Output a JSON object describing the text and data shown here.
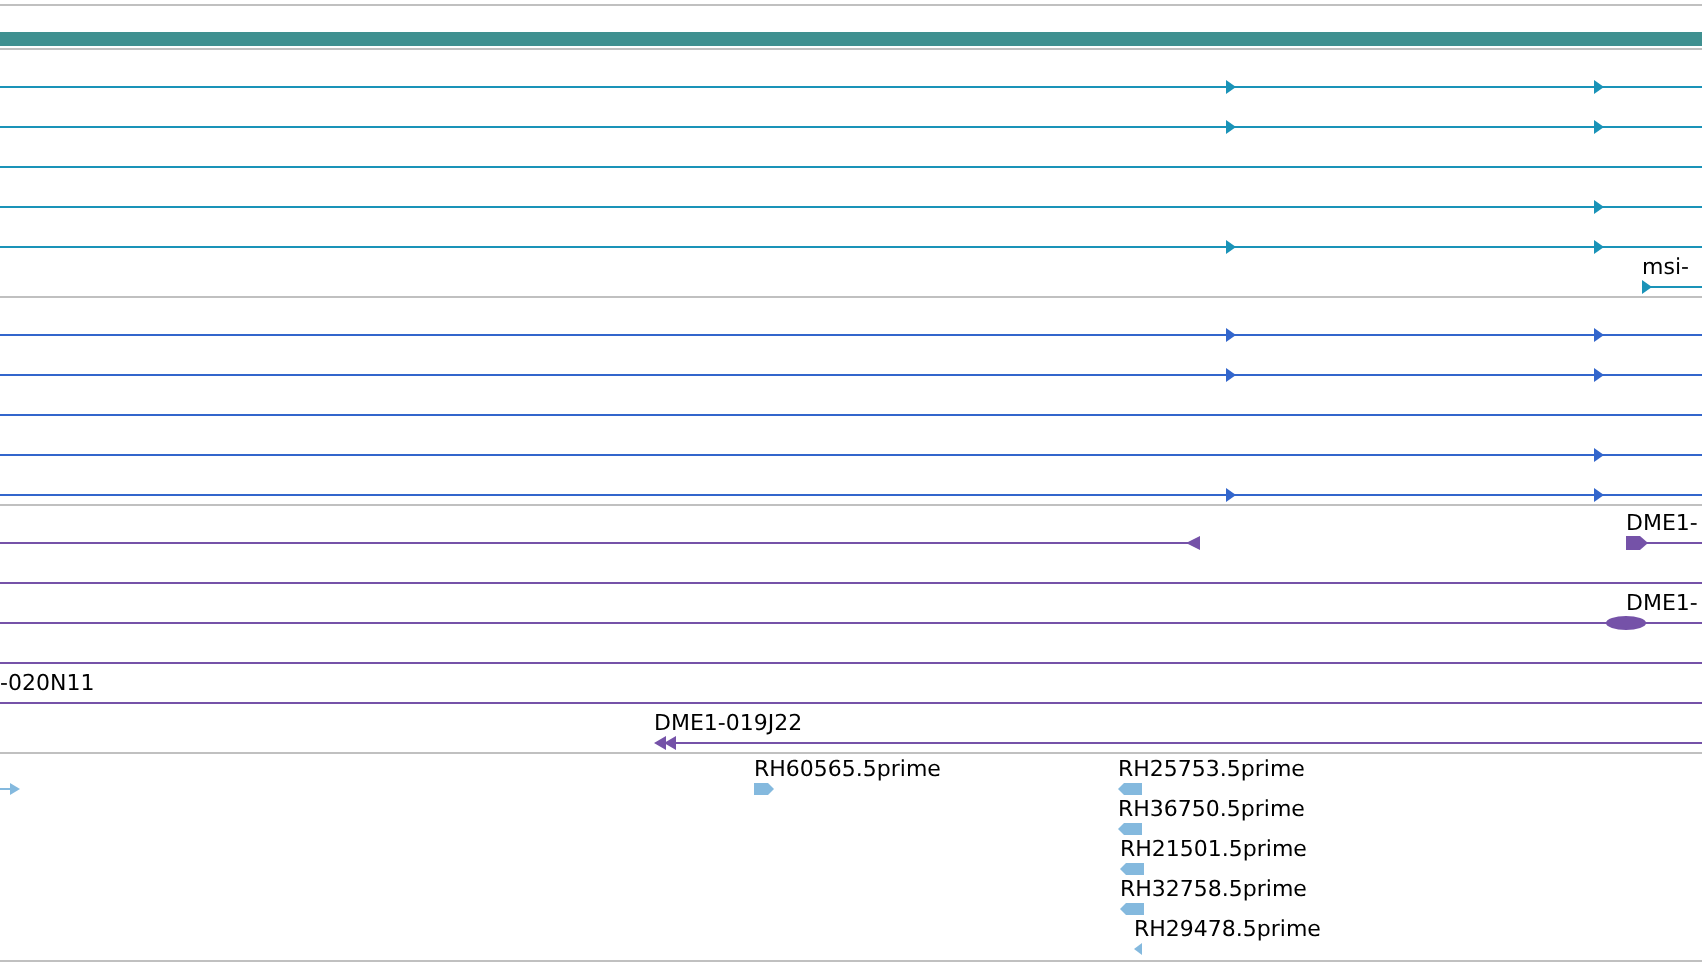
{
  "tracks": [
    {
      "kind": "bar",
      "color": "#3f9090"
    },
    {
      "kind": "transcripts",
      "color": "#1a93b8",
      "labels": [
        "msi-"
      ]
    },
    {
      "kind": "transcripts",
      "color": "#3366cc"
    },
    {
      "kind": "clones",
      "color": "#7552a8",
      "labels": [
        "DME1-",
        "DME1-",
        "-020N11",
        "DME1-019J22"
      ]
    },
    {
      "kind": "ests",
      "color": "#84b9de",
      "labels": [
        "RH60565.5prime",
        "RH25753.5prime",
        "RH36750.5prime",
        "RH21501.5prime",
        "RH32758.5prime",
        "RH29478.5prime"
      ]
    }
  ]
}
